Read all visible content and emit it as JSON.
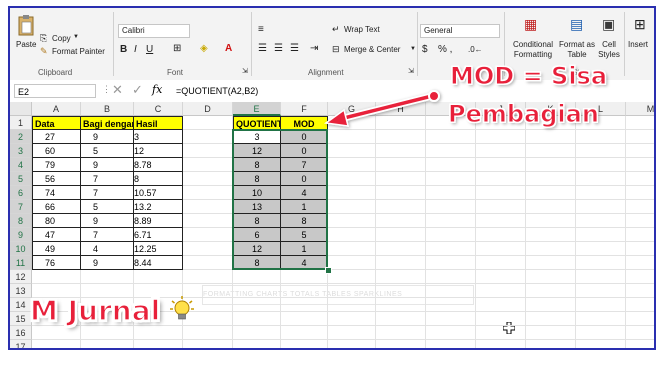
{
  "ribbon": {
    "paste_label": "Paste",
    "copy_label": "Copy",
    "format_painter_label": "Format Painter",
    "clipboard_group": "Clipboard",
    "font_name": "Calibri",
    "font_group": "Font",
    "wrap_text_label": "Wrap Text",
    "merge_label": "Merge & Center",
    "alignment_group": "Alignment",
    "number_format": "General",
    "number_symbols": "% ,",
    "conditional_formatting_label": "Conditional Formatting",
    "format_as_table_label": "Format as Table",
    "cell_styles_label": "Cell Styles",
    "styles_group": "St",
    "insert_label": "Insert"
  },
  "formula_bar": {
    "name_box": "E2",
    "fx": "fx",
    "formula": "=QUOTIENT(A2,B2)"
  },
  "columns": [
    "A",
    "B",
    "C",
    "D",
    "E",
    "F",
    "G",
    "H",
    "I",
    "J",
    "K",
    "L",
    "M"
  ],
  "rows": [
    "1",
    "2",
    "3",
    "4",
    "5",
    "6",
    "7",
    "8",
    "9",
    "10",
    "11",
    "12",
    "13",
    "14",
    "15",
    "16",
    "17"
  ],
  "table1": {
    "headers": [
      "Data",
      "Bagi dengan",
      "Hasil"
    ],
    "rows": [
      [
        "27",
        "9",
        "3"
      ],
      [
        "60",
        "5",
        "12"
      ],
      [
        "79",
        "9",
        "8.78"
      ],
      [
        "56",
        "7",
        "8"
      ],
      [
        "74",
        "7",
        "10.57"
      ],
      [
        "66",
        "5",
        "13.2"
      ],
      [
        "80",
        "9",
        "8.89"
      ],
      [
        "47",
        "7",
        "6.71"
      ],
      [
        "49",
        "4",
        "12.25"
      ],
      [
        "76",
        "9",
        "8.44"
      ]
    ]
  },
  "table2": {
    "headers": [
      "QUOTIENT",
      "MOD"
    ],
    "rows": [
      [
        "3",
        "0"
      ],
      [
        "12",
        "0"
      ],
      [
        "8",
        "7"
      ],
      [
        "8",
        "0"
      ],
      [
        "10",
        "4"
      ],
      [
        "13",
        "1"
      ],
      [
        "8",
        "8"
      ],
      [
        "6",
        "5"
      ],
      [
        "12",
        "1"
      ],
      [
        "8",
        "4"
      ]
    ]
  },
  "ghost_toolbar": "FORMATTING   CHARTS   TOTALS   TABLES   SPARKLINES",
  "annotation": {
    "line1": "MOD = Sisa",
    "line2": "Pembagian",
    "color": "#e8203a"
  },
  "watermark": "M Jurnal",
  "colors": {
    "header_yellow": "#ffff00",
    "selection_gray": "#c8c8c8",
    "excel_green": "#217346",
    "frame_blue": "#2a2fb0"
  }
}
